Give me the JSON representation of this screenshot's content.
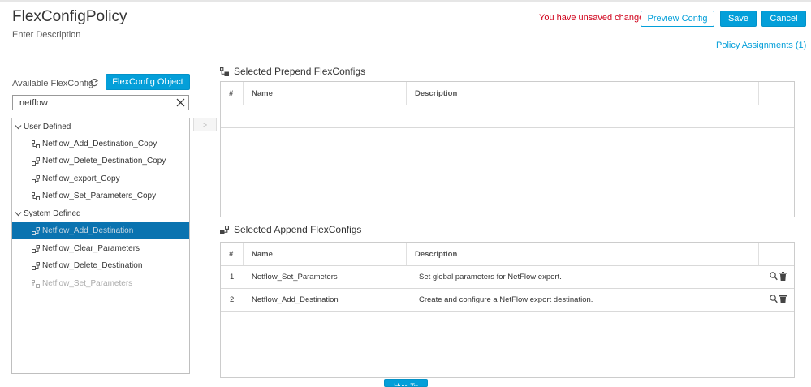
{
  "header": {
    "title": "FlexConfigPolicy",
    "description": "Enter Description",
    "unsaved": "You have unsaved changes",
    "preview_label": "Preview Config",
    "save_label": "Save",
    "cancel_label": "Cancel",
    "policy_assignments": "Policy Assignments (1)"
  },
  "left": {
    "available_label": "Available FlexConfig",
    "object_button": "FlexConfig Object",
    "search_value": "netflow",
    "move_button": ">",
    "groups": [
      {
        "label": "User Defined",
        "items": [
          "Netflow_Add_Destination_Copy",
          "Netflow_Delete_Destination_Copy",
          "Netflow_export_Copy",
          "Netflow_Set_Parameters_Copy"
        ]
      },
      {
        "label": "System Defined",
        "items": [
          "Netflow_Add_Destination",
          "Netflow_Clear_Parameters",
          "Netflow_Delete_Destination",
          "Netflow_Set_Parameters"
        ]
      }
    ]
  },
  "prepend": {
    "title": "Selected Prepend FlexConfigs",
    "columns": [
      "#",
      "Name",
      "Description"
    ]
  },
  "append": {
    "title": "Selected Append FlexConfigs",
    "columns": [
      "#",
      "Name",
      "Description"
    ],
    "rows": [
      {
        "num": "1",
        "name": "Netflow_Set_Parameters",
        "description": "Set global parameters for NetFlow export."
      },
      {
        "num": "2",
        "name": "Netflow_Add_Destination",
        "description": "Create and configure a NetFlow export destination."
      }
    ]
  },
  "footer": {
    "howto_label": "How To"
  },
  "colors": {
    "accent": "#049fd9",
    "selected_row": "#0a73b0",
    "warning": "#d0021b"
  }
}
